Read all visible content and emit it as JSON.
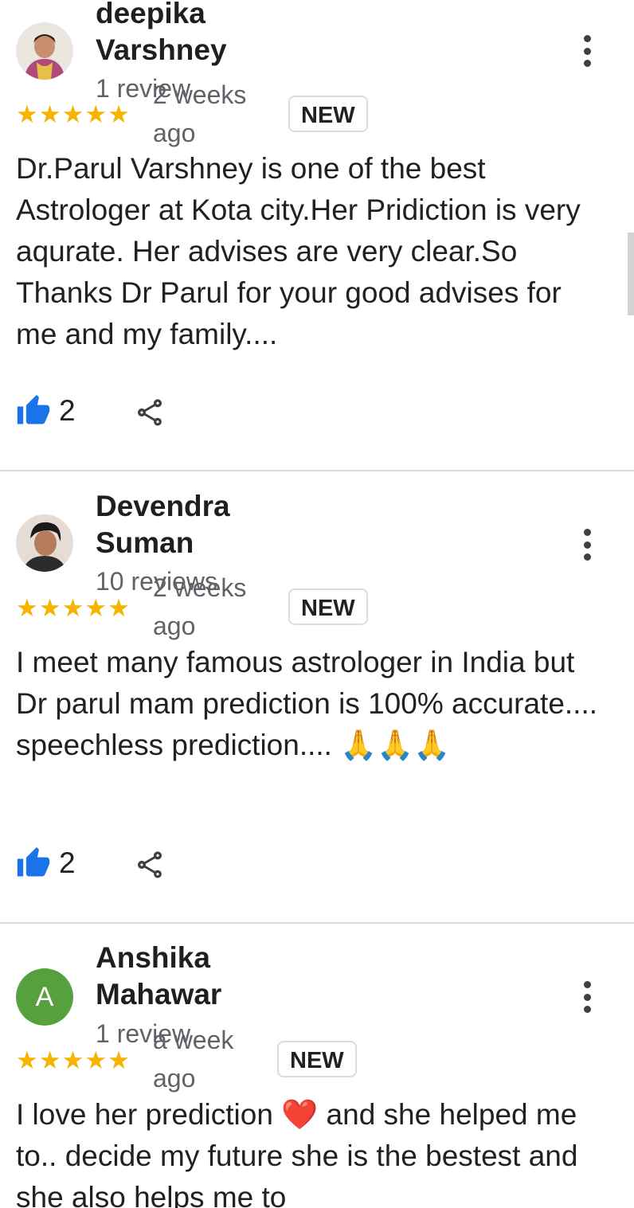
{
  "reviews": [
    {
      "name": "deepika Varshney",
      "review_count": "1 review",
      "time": "2 weeks ago",
      "stars": "★★★★★",
      "badge": "NEW",
      "text": "Dr.Parul Varshney is one of the best Astrologer at Kota city.Her Pridiction is very aqurate. Her advises are very clear.So Thanks Dr Parul for your good advises for me and my family....",
      "likes": "2"
    },
    {
      "name": "Devendra Suman",
      "review_count": "10 reviews",
      "time": "2 weeks ago",
      "stars": "★★★★★",
      "badge": "NEW",
      "text": "I meet many famous astrologer in India but Dr parul mam prediction is 100% accurate.... speechless prediction....",
      "emoji": "🙏🙏🙏",
      "likes": "2"
    },
    {
      "name": "Anshika Mahawar",
      "avatar_letter": "A",
      "review_count": "1 review",
      "time": "a week ago",
      "stars": "★★★★★",
      "badge": "NEW",
      "text_before": "I love her prediction",
      "text_after": "and she helped me to.. decide my future she is the bestest and she also helps me to",
      "emoji": "❤️"
    }
  ],
  "icons": [
    "thumbs-up-icon",
    "share-icon",
    "more-vert-icon"
  ],
  "colors": {
    "star": "#f4b400",
    "like_blue": "#1a73e8",
    "avatar_green": "#57a03e"
  }
}
